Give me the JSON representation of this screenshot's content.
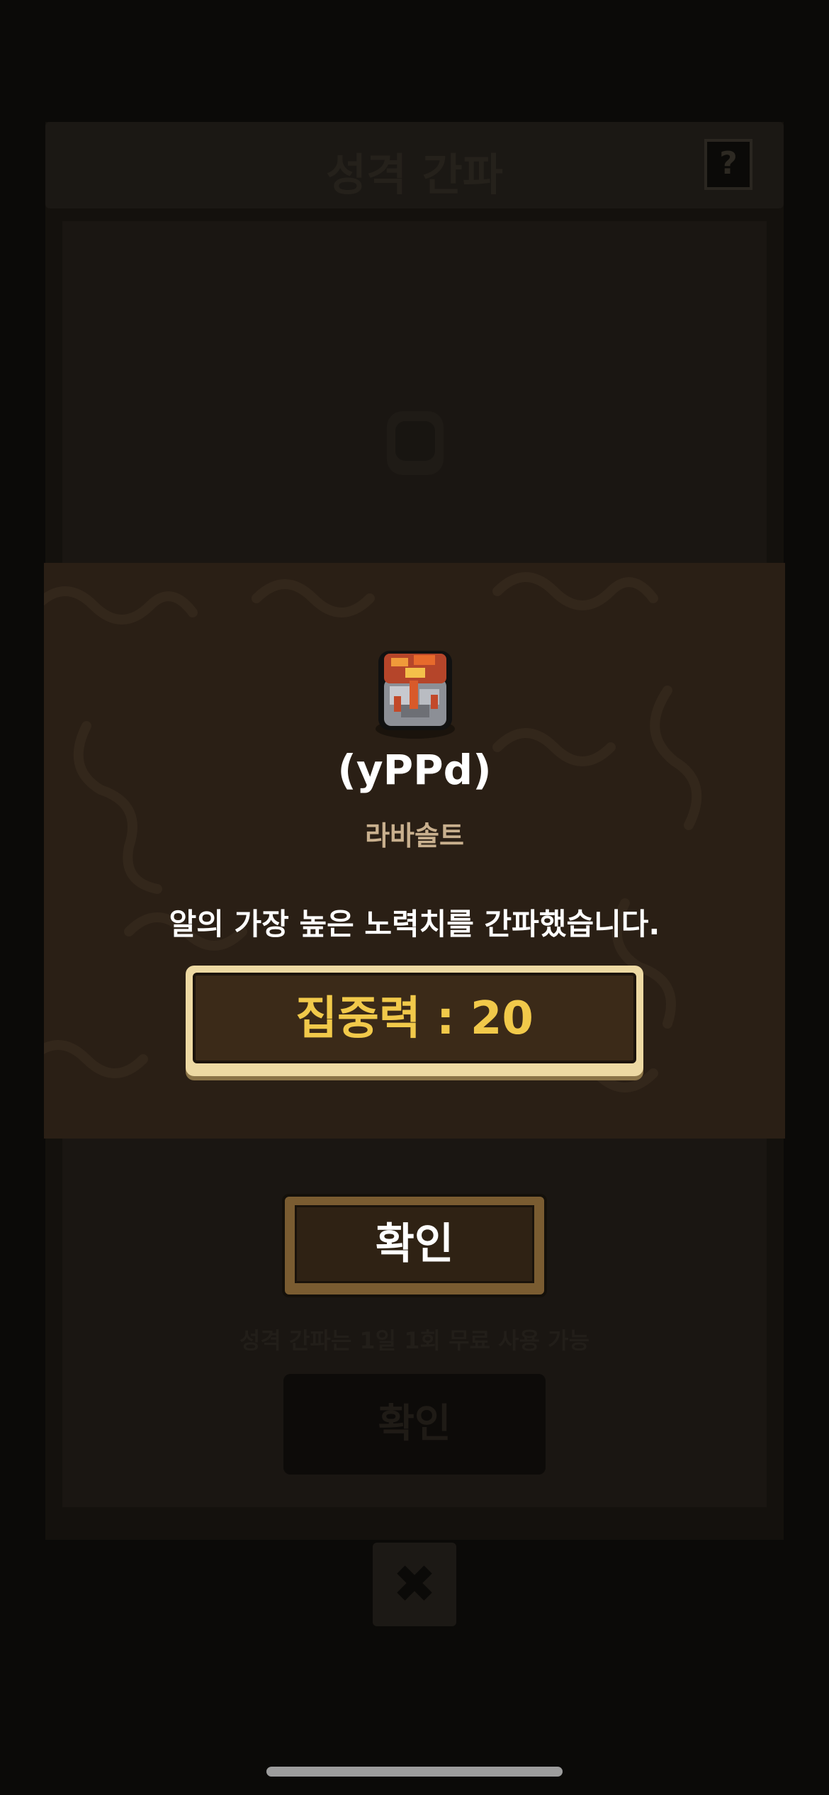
{
  "background": {
    "title": "성격 간파",
    "help_label": "?",
    "hint": "성격 간파는 1일 1회 무료 사용 가능",
    "confirm_label": "확인",
    "close_label": "✖"
  },
  "result": {
    "egg_name": "(yPPd)",
    "egg_type": "라바솔트",
    "message": "알의 가장 높은 노력치를 간파했습니다.",
    "stat_label": "집중력",
    "stat_separator": ":",
    "stat_value": "20",
    "stat_text": "집중력 : 20"
  },
  "confirm_button": {
    "label": "확인"
  },
  "colors": {
    "accent_gold": "#f1c94a",
    "frame_cream": "#edd9a3",
    "band_brown": "#2a1f15"
  },
  "icons": {
    "egg": "lava-egg-icon",
    "close": "close-icon",
    "help": "help-icon"
  }
}
